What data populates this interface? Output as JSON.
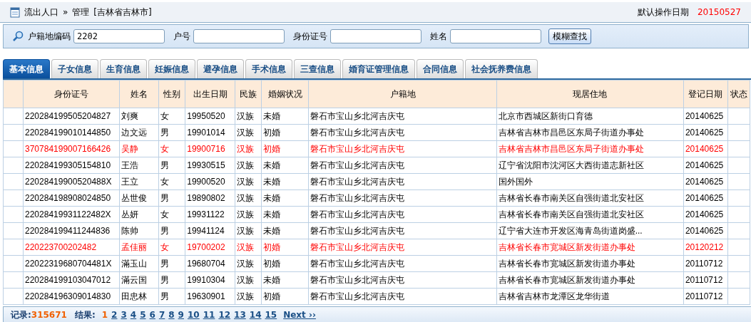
{
  "header": {
    "breadcrumb_section": "流出人口",
    "breadcrumb_sep": "»",
    "breadcrumb_page": "管理",
    "region": "[吉林省吉林市]",
    "date_label": "默认操作日期",
    "date_value": "20150527"
  },
  "search": {
    "fields": [
      {
        "label": "户籍地编码",
        "value": "2202"
      },
      {
        "label": "户号"
      },
      {
        "label": "身份证号"
      },
      {
        "label": "姓名"
      }
    ],
    "button": "模糊查找"
  },
  "tabs": [
    {
      "label": "基本信息",
      "selected": true
    },
    {
      "label": "子女信息",
      "selected": false
    },
    {
      "label": "生育信息",
      "selected": false
    },
    {
      "label": "妊娠信息",
      "selected": false
    },
    {
      "label": "避孕信息",
      "selected": false
    },
    {
      "label": "手术信息",
      "selected": false
    },
    {
      "label": "三查信息",
      "selected": false
    },
    {
      "label": "婚育证管理信息",
      "selected": false
    },
    {
      "label": "合同信息",
      "selected": false
    },
    {
      "label": "社会抚养费信息",
      "selected": false
    }
  ],
  "table": {
    "columns": [
      "身份证号",
      "姓名",
      "性别",
      "出生日期",
      "民族",
      "婚姻状况",
      "户籍地",
      "现居住地",
      "登记日期",
      "状态"
    ],
    "rows": [
      {
        "flagged": false,
        "cells": [
          "220284199505204827",
          "刘爽",
          "女",
          "19950520",
          "汉族",
          "未婚",
          "磐石市宝山乡北河吉庆屯",
          "北京市西城区新街口育德",
          "20140625"
        ]
      },
      {
        "flagged": false,
        "cells": [
          "220284199010144850",
          "边文远",
          "男",
          "19901014",
          "汉族",
          "初婚",
          "磐石市宝山乡北河吉庆屯",
          "吉林省吉林市昌邑区东局子街道办事处",
          "20140625"
        ]
      },
      {
        "flagged": true,
        "cells": [
          "370784199007166426",
          "吴静",
          "女",
          "19900716",
          "汉族",
          "初婚",
          "磐石市宝山乡北河吉庆屯",
          "吉林省吉林市昌邑区东局子街道办事处",
          "20140625"
        ]
      },
      {
        "flagged": false,
        "cells": [
          "220284199305154810",
          "王浩",
          "男",
          "19930515",
          "汉族",
          "未婚",
          "磐石市宝山乡北河吉庆屯",
          "辽宁省沈阳市沈河区大西街道志新社区",
          "20140625"
        ]
      },
      {
        "flagged": false,
        "cells": [
          "22028419900520488X",
          "王立",
          "女",
          "19900520",
          "汉族",
          "未婚",
          "磐石市宝山乡北河吉庆屯",
          "国外国外",
          "20140625"
        ]
      },
      {
        "flagged": false,
        "cells": [
          "220284198908024850",
          "丛世俊",
          "男",
          "19890802",
          "汉族",
          "未婚",
          "磐石市宝山乡北河吉庆屯",
          "吉林省长春市南关区自强街道北安社区",
          "20140625"
        ]
      },
      {
        "flagged": false,
        "cells": [
          "22028419931122482X",
          "丛妍",
          "女",
          "19931122",
          "汉族",
          "未婚",
          "磐石市宝山乡北河吉庆屯",
          "吉林省长春市南关区自强街道北安社区",
          "20140625"
        ]
      },
      {
        "flagged": false,
        "cells": [
          "220284199411244836",
          "陈帅",
          "男",
          "19941124",
          "汉族",
          "未婚",
          "磐石市宝山乡北河吉庆屯",
          "辽宁省大连市开发区海青岛街道岗盛...",
          "20140625"
        ]
      },
      {
        "flagged": true,
        "cells": [
          "220223700202482",
          "孟佳丽",
          "女",
          "19700202",
          "汉族",
          "初婚",
          "磐石市宝山乡北河吉庆屯",
          "吉林省长春市宽城区新发街道办事处",
          "20120212"
        ]
      },
      {
        "flagged": false,
        "cells": [
          "22022319680704481X",
          "滿玉山",
          "男",
          "19680704",
          "汉族",
          "初婚",
          "磐石市宝山乡北河吉庆屯",
          "吉林省长春市宽城区新发街道办事处",
          "20110712"
        ]
      },
      {
        "flagged": false,
        "cells": [
          "220284199103047012",
          "滿云国",
          "男",
          "19910304",
          "汉族",
          "未婚",
          "磐石市宝山乡北河吉庆屯",
          "吉林省长春市宽城区新发街道办事处",
          "20110712"
        ]
      },
      {
        "flagged": false,
        "cells": [
          "220284196309014830",
          "田忠林",
          "男",
          "19630901",
          "汉族",
          "初婚",
          "磐石市宝山乡北河吉庆屯",
          "吉林省吉林市龙潭区龙华街道",
          "20110712"
        ]
      }
    ]
  },
  "pager": {
    "records_label": "记录:",
    "records_value": "315671",
    "results_label": "结果:",
    "pages": [
      {
        "label": "1",
        "selected": true
      },
      {
        "label": "2",
        "selected": false
      },
      {
        "label": "3",
        "selected": false
      },
      {
        "label": "4",
        "selected": false
      },
      {
        "label": "5",
        "selected": false
      },
      {
        "label": "6",
        "selected": false
      },
      {
        "label": "7",
        "selected": false
      },
      {
        "label": "8",
        "selected": false
      },
      {
        "label": "9",
        "selected": false
      },
      {
        "label": "10",
        "selected": false
      },
      {
        "label": "11",
        "selected": false
      },
      {
        "label": "12",
        "selected": false
      },
      {
        "label": "13",
        "selected": false
      },
      {
        "label": "14",
        "selected": false
      },
      {
        "label": "15",
        "selected": false
      }
    ],
    "next": "Next ››"
  }
}
